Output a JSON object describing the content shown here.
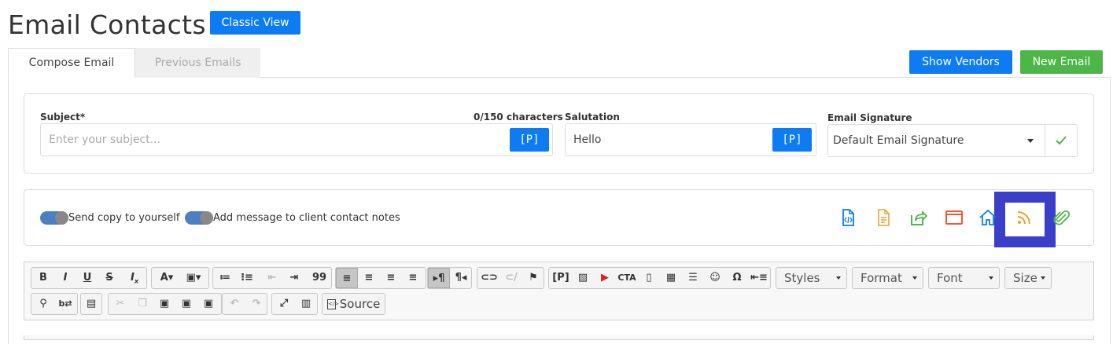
{
  "page": {
    "title": "Email Contacts",
    "classic_view": "Classic View"
  },
  "tabs": [
    {
      "label": "Compose Email",
      "active": true
    },
    {
      "label": "Previous Emails",
      "active": false
    }
  ],
  "actions": {
    "show_vendors": "Show Vendors",
    "new_email": "New Email"
  },
  "form": {
    "subject_label": "Subject*",
    "subject_placeholder": "Enter your subject...",
    "subject_value": "",
    "char_count": "0/150 characters",
    "p_button": "[P]",
    "salutation_label": "Salutation",
    "salutation_value": "Hello",
    "signature_label": "Email Signature",
    "signature_value": "Default Email Signature"
  },
  "options": {
    "send_copy": "Send copy to yourself",
    "add_notes": "Add message to client contact notes",
    "icons": [
      "code-file-icon",
      "document-icon",
      "share-icon",
      "browser-window-icon",
      "home-icon",
      "rss-icon",
      "paperclip-icon"
    ]
  },
  "editor": {
    "styles": "Styles",
    "format": "Format",
    "font": "Font",
    "size": "Size",
    "source": "Source"
  },
  "colors": {
    "primary": "#0d7cf2",
    "success": "#4cb648",
    "highlight": "#3a3ec9",
    "toggle": "#4a7fc1"
  }
}
